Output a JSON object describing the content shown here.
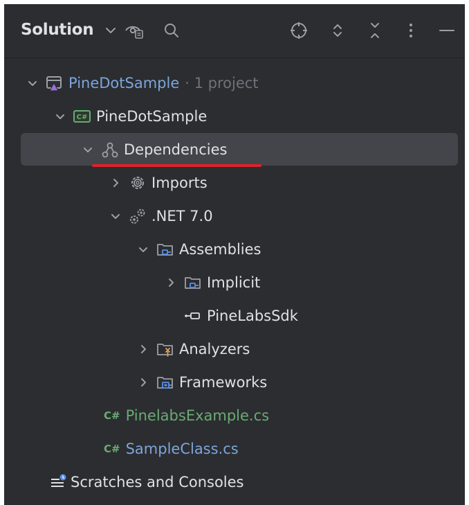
{
  "header": {
    "title": "Solution",
    "icons": [
      "chevron-down-icon",
      "eye-filter-icon",
      "search-icon",
      "locate-icon",
      "expand-all-icon",
      "collapse-all-icon",
      "more-vertical-icon",
      "minimize-icon"
    ]
  },
  "tree": {
    "solution": {
      "name": "PineDotSample",
      "meta": "· 1 project"
    },
    "project": {
      "name": "PineDotSample",
      "badge": "C#"
    },
    "dependencies": "Dependencies",
    "imports": "Imports",
    "net": ".NET 7.0",
    "assemblies": "Assemblies",
    "implicit": "Implicit",
    "pinelabs_sdk": "PineLabsSdk",
    "analyzers": "Analyzers",
    "frameworks": "Frameworks",
    "file1": {
      "badge": "C#",
      "name": "PinelabsExample.cs"
    },
    "file2": {
      "badge": "C#",
      "name": "SampleClass.cs"
    },
    "scratches": "Scratches and Consoles"
  },
  "colors": {
    "panel_bg": "#2b2d30",
    "selected_bg": "#43454a",
    "text": "#dfe1e5",
    "muted": "#6f737a",
    "blue_file": "#7ea5da",
    "green_file": "#6aab73",
    "underline": "#e0212b"
  }
}
